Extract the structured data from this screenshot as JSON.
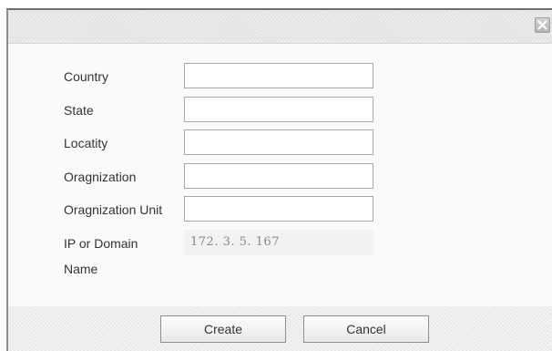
{
  "dialog": {
    "close_icon": "close-icon",
    "fields": [
      {
        "label": "Country",
        "value": ""
      },
      {
        "label": "State",
        "value": ""
      },
      {
        "label": "Locatity",
        "value": ""
      },
      {
        "label": "Oragnization",
        "value": ""
      },
      {
        "label": "Oragnization Unit",
        "value": ""
      }
    ],
    "ip_field": {
      "label_line1": "IP or Domain",
      "label_line2": "Name",
      "value": "172. 3. 5. 167"
    },
    "buttons": {
      "create_label": "Create",
      "cancel_label": "Cancel"
    }
  }
}
